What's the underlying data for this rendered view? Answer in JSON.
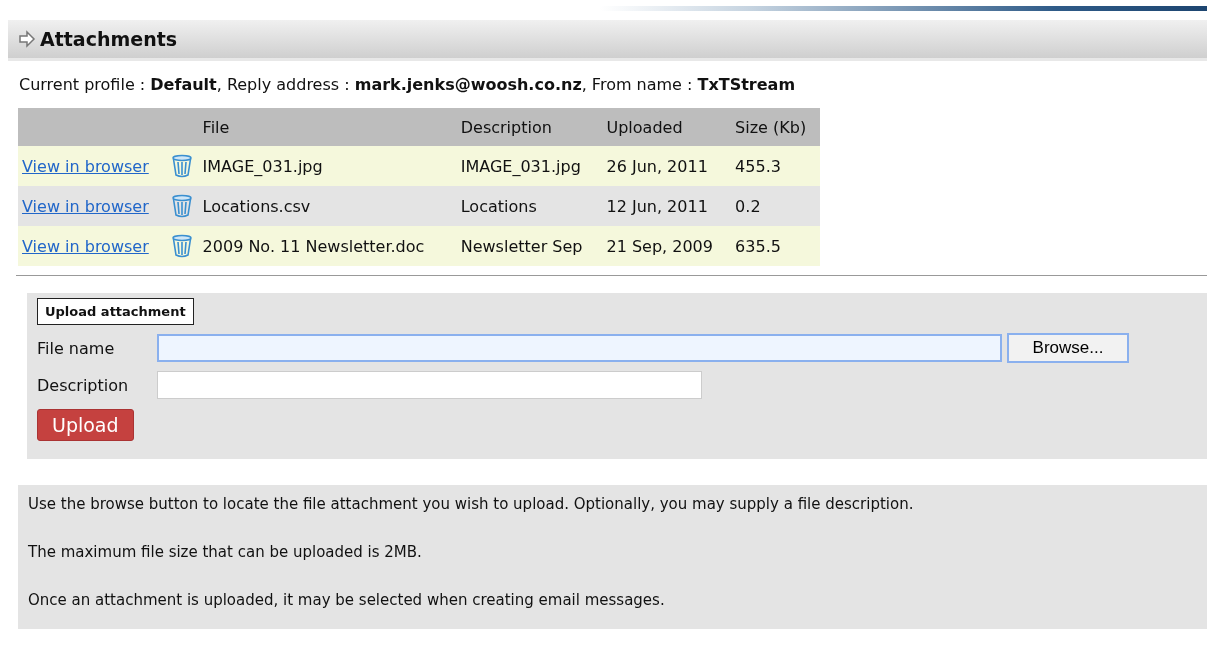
{
  "section": {
    "title": "Attachments"
  },
  "profile_line": "Current profile : **Default**, Reply address : **mark.jenks@woosh.co.nz**, From name : **TxTStream**",
  "table": {
    "columns": [
      "File",
      "Description",
      "Uploaded",
      "Size (Kb)"
    ],
    "rows": [
      {
        "link": "View in browser",
        "file": "IMAGE_031.jpg",
        "description": "IMAGE_031.jpg",
        "uploaded": "26 Jun, 2011",
        "size": "455.3"
      },
      {
        "link": "View in browser",
        "file": "Locations.csv",
        "description": "Locations",
        "uploaded": "12 Jun, 2011",
        "size": "0.2"
      },
      {
        "link": "View in browser",
        "file": "2009 No. 11 Newsletter.doc",
        "description": "Newsletter Sep",
        "uploaded": "21 Sep, 2009",
        "size": "635.5"
      }
    ]
  },
  "upload": {
    "legend": "Upload attachment",
    "file_name": {
      "label": "File name",
      "focused": true,
      "button": "Browse..."
    },
    "description": {
      "label": "Description"
    },
    "submit": "Upload"
  },
  "help": [
    "Use the browse button to locate the file attachment you wish to upload. Optionally, you may supply a file description.",
    "The maximum file size that can be uploaded is 2MB.",
    "Once an attachment is uploaded, it may be selected when creating email messages."
  ]
}
